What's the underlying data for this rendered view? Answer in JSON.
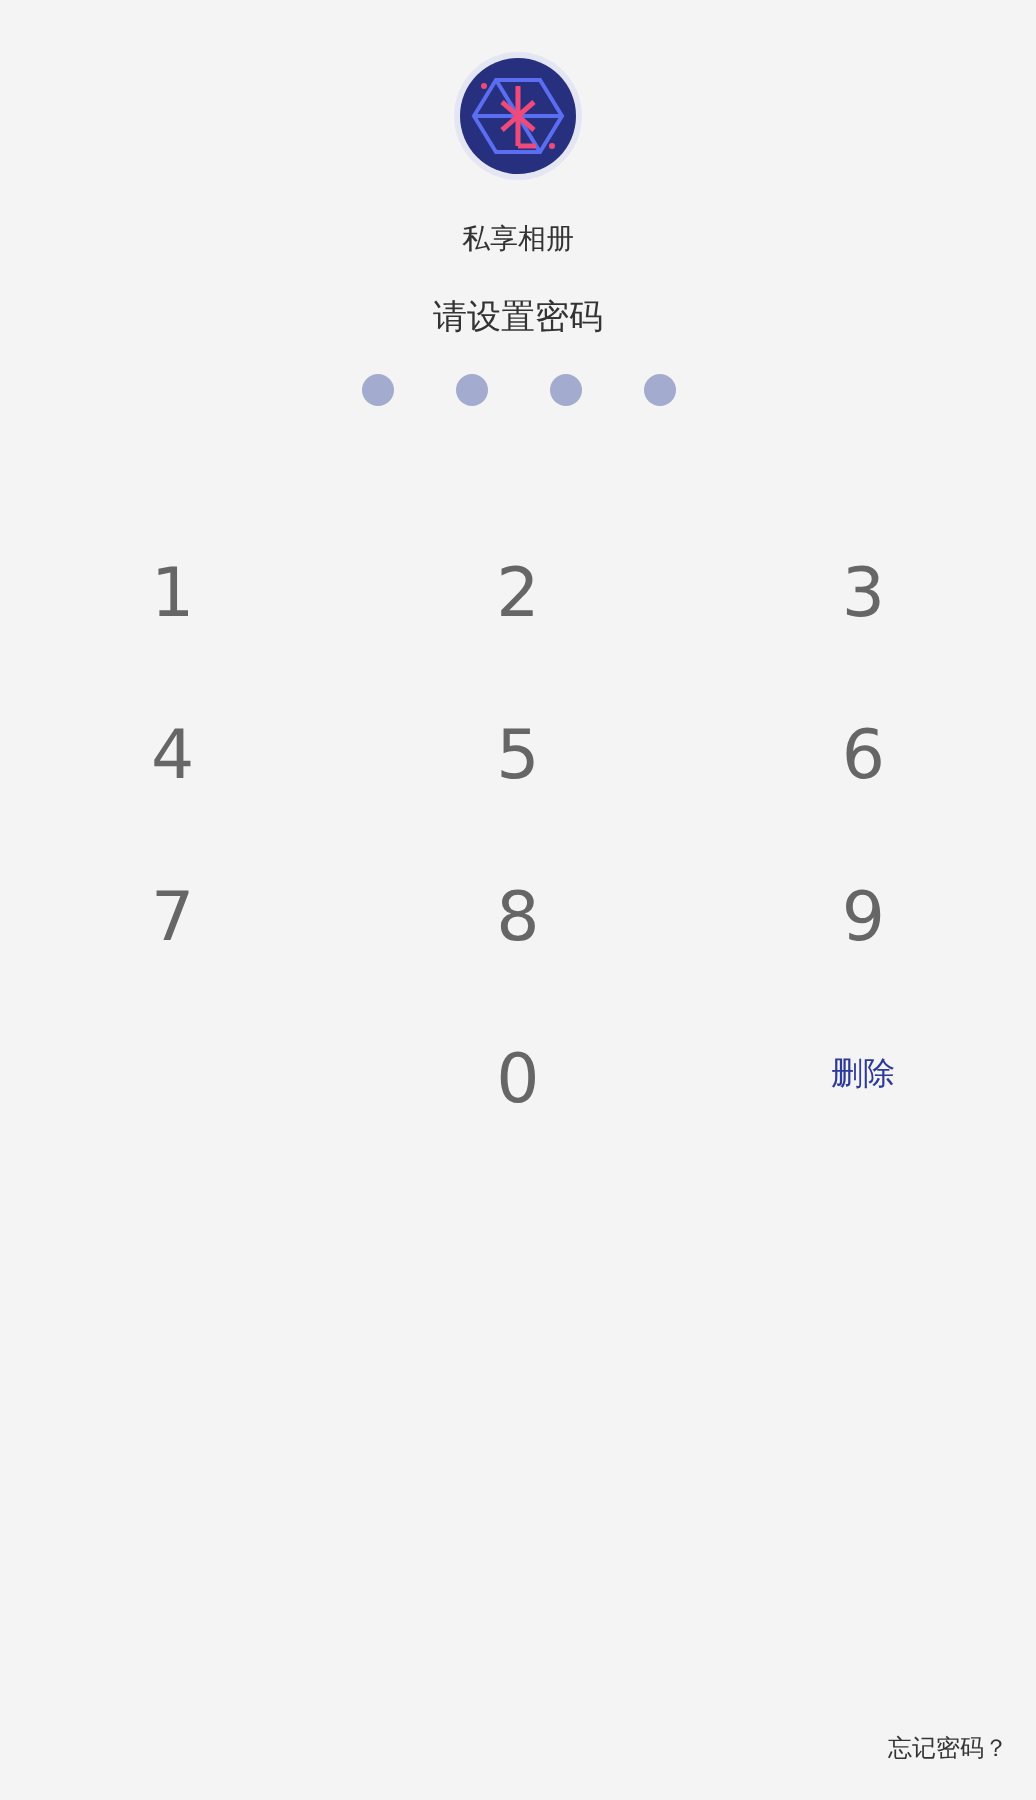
{
  "app": {
    "name": "私享相册"
  },
  "prompt": "请设置密码",
  "pin_dots": [
    {
      "filled": false
    },
    {
      "filled": false
    },
    {
      "filled": false
    },
    {
      "filled": false
    }
  ],
  "keypad": [
    {
      "kind": "digit",
      "label": "1"
    },
    {
      "kind": "digit",
      "label": "2"
    },
    {
      "kind": "digit",
      "label": "3"
    },
    {
      "kind": "digit",
      "label": "4"
    },
    {
      "kind": "digit",
      "label": "5"
    },
    {
      "kind": "digit",
      "label": "6"
    },
    {
      "kind": "digit",
      "label": "7"
    },
    {
      "kind": "digit",
      "label": "8"
    },
    {
      "kind": "digit",
      "label": "9"
    },
    {
      "kind": "blank"
    },
    {
      "kind": "digit",
      "label": "0"
    },
    {
      "kind": "action",
      "label": "删除"
    }
  ],
  "forgot_link": "忘记密码？"
}
